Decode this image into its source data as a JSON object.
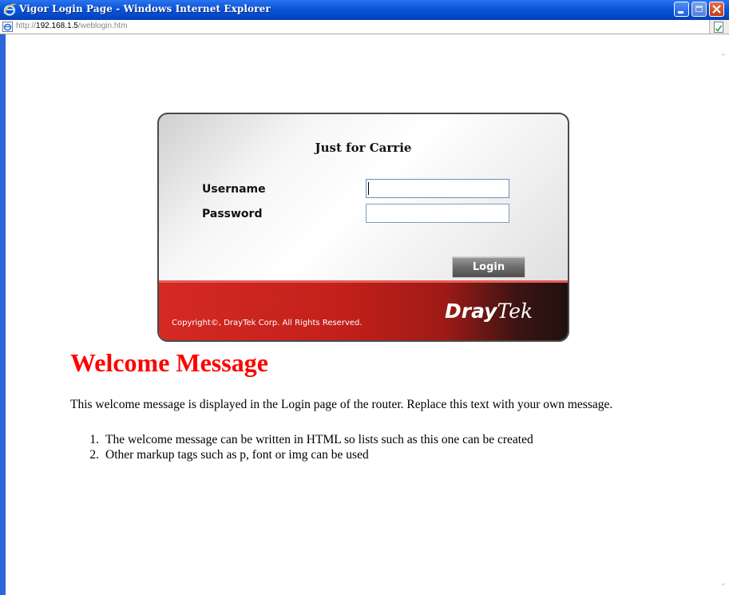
{
  "window": {
    "title": "Vigor Login Page - Windows Internet Explorer",
    "address_prefix": "http://",
    "address_host": "192.168.1.5",
    "address_path": "/weblogin.htm"
  },
  "login": {
    "header": "Just for Carrie",
    "username_label": "Username",
    "password_label": "Password",
    "username_value": "",
    "password_value": "",
    "button_label": "Login",
    "copyright": "Copyright©, DrayTek Corp. All Rights Reserved.",
    "brand_part1": "Dray",
    "brand_part2": "Tek"
  },
  "welcome": {
    "heading": "Welcome Message",
    "text": "This welcome message is displayed in the Login page of the router. Replace this text with your own message.",
    "list": [
      {
        "num": "1.",
        "text": "The welcome message can be written in HTML so lists such as this one can be created"
      },
      {
        "num": "2.",
        "text": "Other markup tags such as p, font or img can be used"
      }
    ]
  },
  "colors": {
    "heading": "#ff0000",
    "titlebar": "#0a54d8",
    "footer": "#c3201b"
  },
  "icons": [
    "ie-logo-icon",
    "page-icon",
    "page-status-icon",
    "minimize-icon",
    "maximize-icon",
    "close-icon",
    "scroll-up-icon",
    "scroll-down-icon"
  ]
}
